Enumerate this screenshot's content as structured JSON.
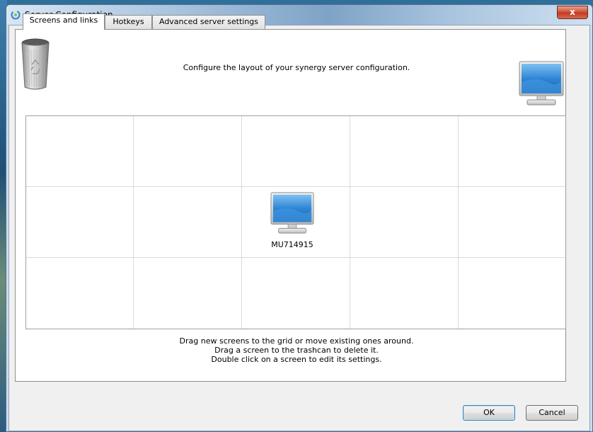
{
  "window": {
    "title": "Server Configuration",
    "close_glyph": "x"
  },
  "tabs": [
    {
      "label": "Screens and links",
      "active": true
    },
    {
      "label": "Hotkeys",
      "active": false
    },
    {
      "label": "Advanced server settings",
      "active": false
    }
  ],
  "screens_panel": {
    "instruction": "Configure the layout of your synergy server configuration.",
    "trash_icon": "trash-can-icon",
    "new_screen_icon": "monitor-icon",
    "grid": {
      "columns": 5,
      "rows": 3,
      "screens": [
        {
          "name": "MU714915",
          "row": 1,
          "column": 2,
          "icon": "monitor-icon"
        }
      ]
    },
    "help_lines": [
      "Drag new screens to the grid or move existing ones around.",
      "Drag a screen to the trashcan to delete it.",
      "Double click on a screen to edit its settings."
    ]
  },
  "buttons": {
    "ok": "OK",
    "cancel": "Cancel"
  },
  "colors": {
    "titlebar": "#a6c2de",
    "close_button": "#c23a20",
    "monitor_screen": "#2f86d6"
  }
}
